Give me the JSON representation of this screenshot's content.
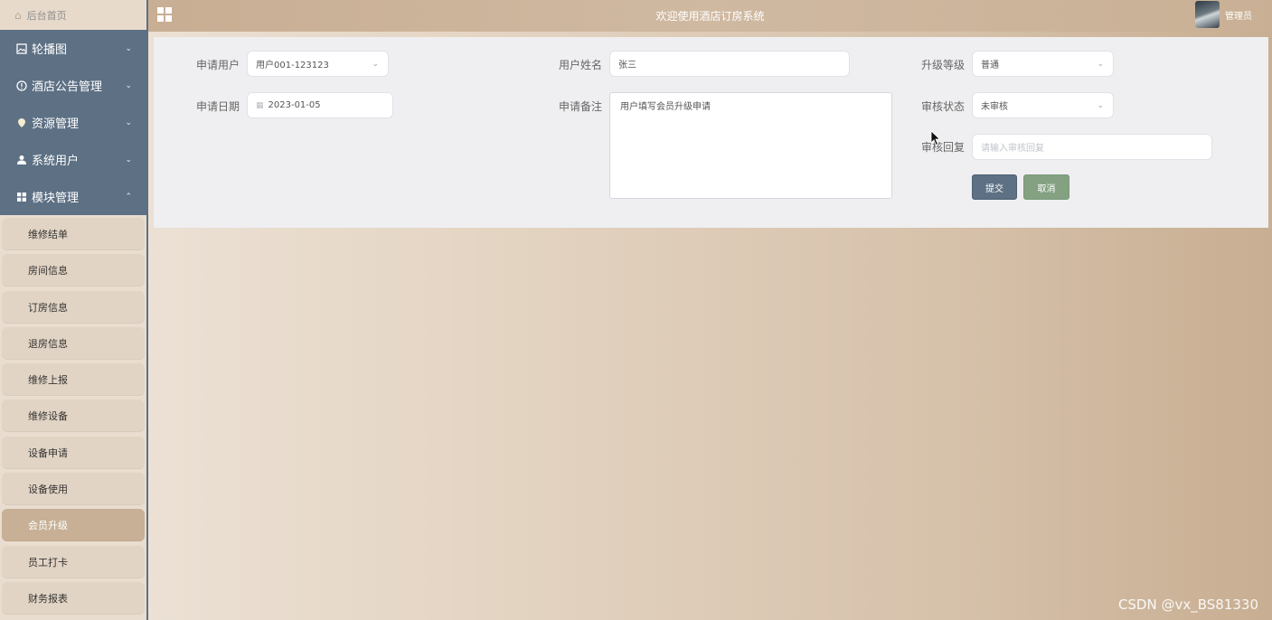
{
  "header": {
    "title": "欢迎使用酒店订房系统",
    "user_name": "管理员"
  },
  "sidebar": {
    "home": "后台首页",
    "menus": [
      {
        "label": "轮播图",
        "icon": "image-icon",
        "expanded": false
      },
      {
        "label": "酒店公告管理",
        "icon": "info-circle-icon",
        "expanded": false
      },
      {
        "label": "资源管理",
        "icon": "location-pin-icon",
        "expanded": false
      },
      {
        "label": "系统用户",
        "icon": "user-icon",
        "expanded": false
      },
      {
        "label": "模块管理",
        "icon": "grid-icon",
        "expanded": true
      }
    ],
    "submenu": [
      "维修结单",
      "房间信息",
      "订房信息",
      "退房信息",
      "维修上报",
      "维修设备",
      "设备申请",
      "设备使用",
      "会员升级",
      "员工打卡",
      "财务报表"
    ],
    "active_submenu": "会员升级"
  },
  "form": {
    "apply_user": {
      "label": "申请用户",
      "value": "用户001-123123"
    },
    "user_name": {
      "label": "用户姓名",
      "value": "张三"
    },
    "upgrade_level": {
      "label": "升级等级",
      "value": "普通"
    },
    "apply_date": {
      "label": "申请日期",
      "value": "2023-01-05"
    },
    "apply_note": {
      "label": "申请备注",
      "value": "用户填写会员升级申请"
    },
    "review_status": {
      "label": "审核状态",
      "value": "未审核"
    },
    "review_reply": {
      "label": "审核回复",
      "placeholder": "请输入审核回复"
    },
    "submit_label": "提交",
    "cancel_label": "取消"
  },
  "watermark": "CSDN @vx_BS81330",
  "colors": {
    "sidebar_menu": "#5d7084",
    "active_submenu": "#c7b095",
    "submit_button": "#5d7084",
    "cancel_button": "#84a282"
  }
}
